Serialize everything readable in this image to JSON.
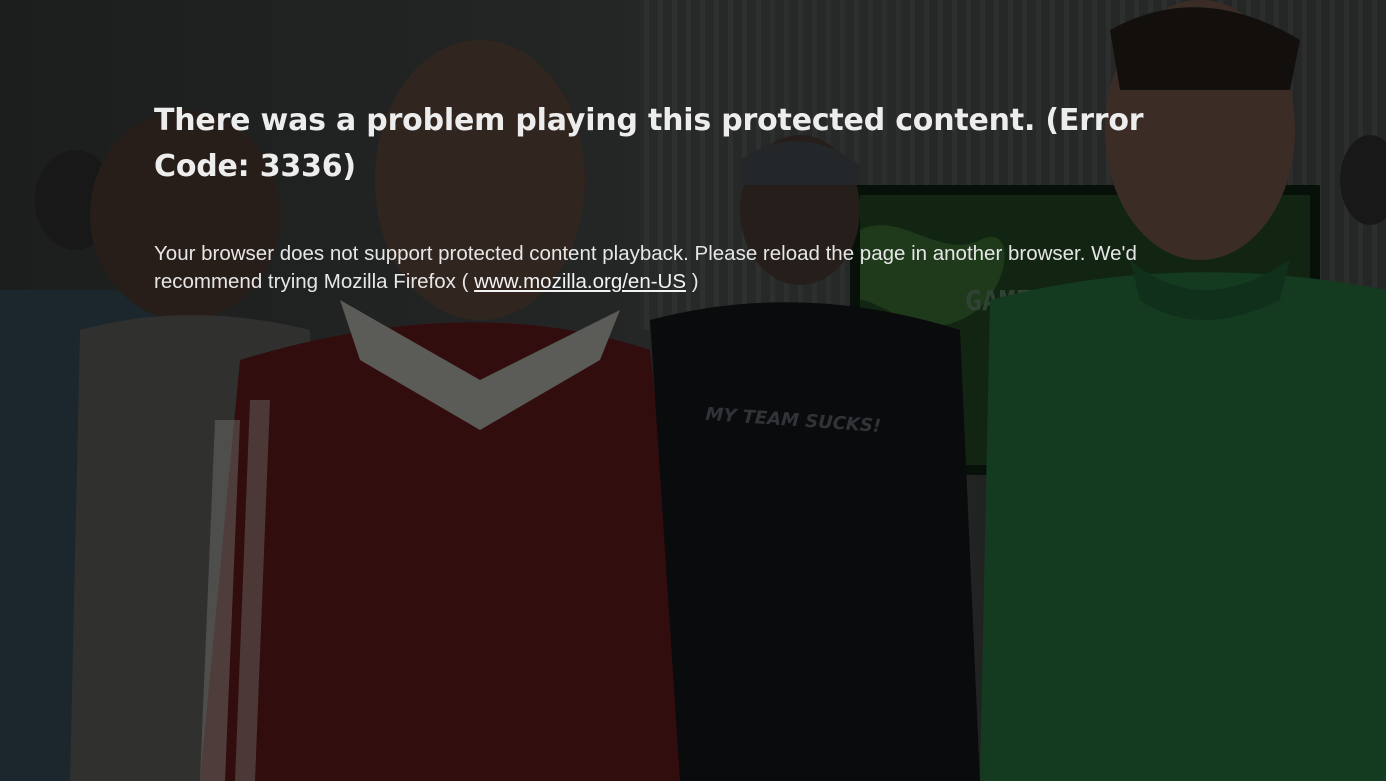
{
  "error": {
    "title_prefix": "There was a problem playing this protected content. (Error Code: ",
    "error_code": "3336",
    "title_suffix": ")",
    "detail_text": "Your browser does not support protected content playback. Please reload the page in another browser. We'd recommend trying Mozilla Firefox ( ",
    "link_text": "www.mozilla.org/en-US",
    "detail_suffix": " )"
  },
  "backdrop": {
    "shirt_text": "MY TEAM SUCKS!",
    "screen_text": "GAME"
  },
  "colors": {
    "text": "#ededed",
    "overlay": "#000000"
  }
}
